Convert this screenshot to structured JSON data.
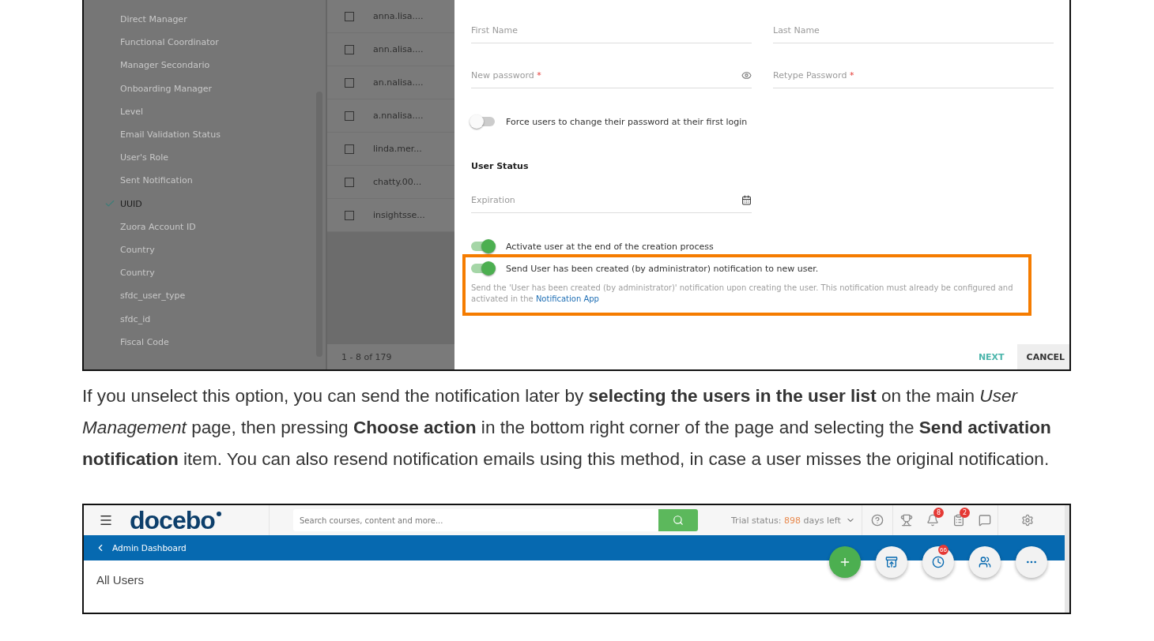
{
  "shot_1": {
    "columns_menu": {
      "items": [
        {
          "label": "Direct Manager",
          "checked": false
        },
        {
          "label": "Functional Coordinator",
          "checked": false
        },
        {
          "label": "Manager Secondario",
          "checked": false
        },
        {
          "label": "Onboarding Manager",
          "checked": false
        },
        {
          "label": "Level",
          "checked": false
        },
        {
          "label": "Email Validation Status",
          "checked": false
        },
        {
          "label": "User's Role",
          "checked": false
        },
        {
          "label": "Sent Notification",
          "checked": false
        },
        {
          "label": "UUID",
          "checked": true
        },
        {
          "label": "Zuora Account ID",
          "checked": false
        },
        {
          "label": "Country",
          "checked": false
        },
        {
          "label": "Country",
          "checked": false
        },
        {
          "label": "sfdc_user_type",
          "checked": false
        },
        {
          "label": "sfdc_id",
          "checked": false
        },
        {
          "label": "Fiscal Code",
          "checked": false
        }
      ]
    },
    "users_table": {
      "rows": [
        {
          "selected": false,
          "username": "anna.lisa...."
        },
        {
          "selected": false,
          "username": "ann.alisa...."
        },
        {
          "selected": false,
          "username": "an.nalisa...."
        },
        {
          "selected": false,
          "username": "a.nnalisa...."
        },
        {
          "selected": false,
          "username": "linda.mer..."
        },
        {
          "selected": false,
          "username": "chatty.00..."
        },
        {
          "selected": false,
          "username": "insightsse..."
        }
      ],
      "pagination": "1 - 8 of 179"
    },
    "create_user_form": {
      "fields": [
        {
          "label": "First Name",
          "required": false,
          "kind": "text"
        },
        {
          "label": "Last Name",
          "required": false,
          "kind": "text"
        },
        {
          "label": "New password",
          "required": true,
          "kind": "password"
        },
        {
          "label": "Retype Password",
          "required": true,
          "kind": "text"
        }
      ],
      "required_mark": "*",
      "force_password_change": {
        "label": "Force users to change their password at their first login",
        "on": false
      },
      "user_status": {
        "heading": "User Status",
        "expiration": {
          "label": "Expiration"
        }
      },
      "activate_user": {
        "label": "Activate user at the end of the creation process",
        "on": true
      },
      "send_notification": {
        "label": "Send User has been created (by administrator) notification to new user.",
        "on": true,
        "highlighted": true,
        "description": "Send the 'User has been created (by administrator)' notification upon creating the user. This notification must already be configured and activated in the",
        "link": "Notification App"
      },
      "buttons": [
        {
          "label": "NEXT",
          "kind": "text"
        },
        {
          "label": "CANCEL",
          "kind": "filled"
        }
      ]
    }
  },
  "paragraph": "If you unselect this option, you can send the notification later by **selecting the users in the user list** on the main *User Management* page, then pressing **Choose action** in the bottom right corner of the page and selecting the **Send activation notification** item. You can also resend notification emails using this method, in case a user misses the original notification.",
  "shot_2": {
    "header": {
      "logo": "docebo",
      "search": {
        "placeholder": "Search courses, content and more..."
      },
      "trial_status": {
        "label": "Trial status:",
        "days": "898",
        "suffix": "days left"
      },
      "icons": [
        {
          "kind": "help"
        },
        {
          "kind": "trophy"
        },
        {
          "kind": "bell",
          "badge": "8"
        },
        {
          "kind": "clipboard",
          "badge": "2"
        },
        {
          "kind": "chat"
        },
        {
          "kind": "settings"
        }
      ]
    },
    "breadcrumb": "Admin Dashboard",
    "title": "All Users",
    "actions": [
      {
        "kind": "add"
      },
      {
        "kind": "archive"
      },
      {
        "kind": "clock",
        "badge": "66"
      },
      {
        "kind": "users"
      },
      {
        "kind": "more"
      }
    ]
  }
}
